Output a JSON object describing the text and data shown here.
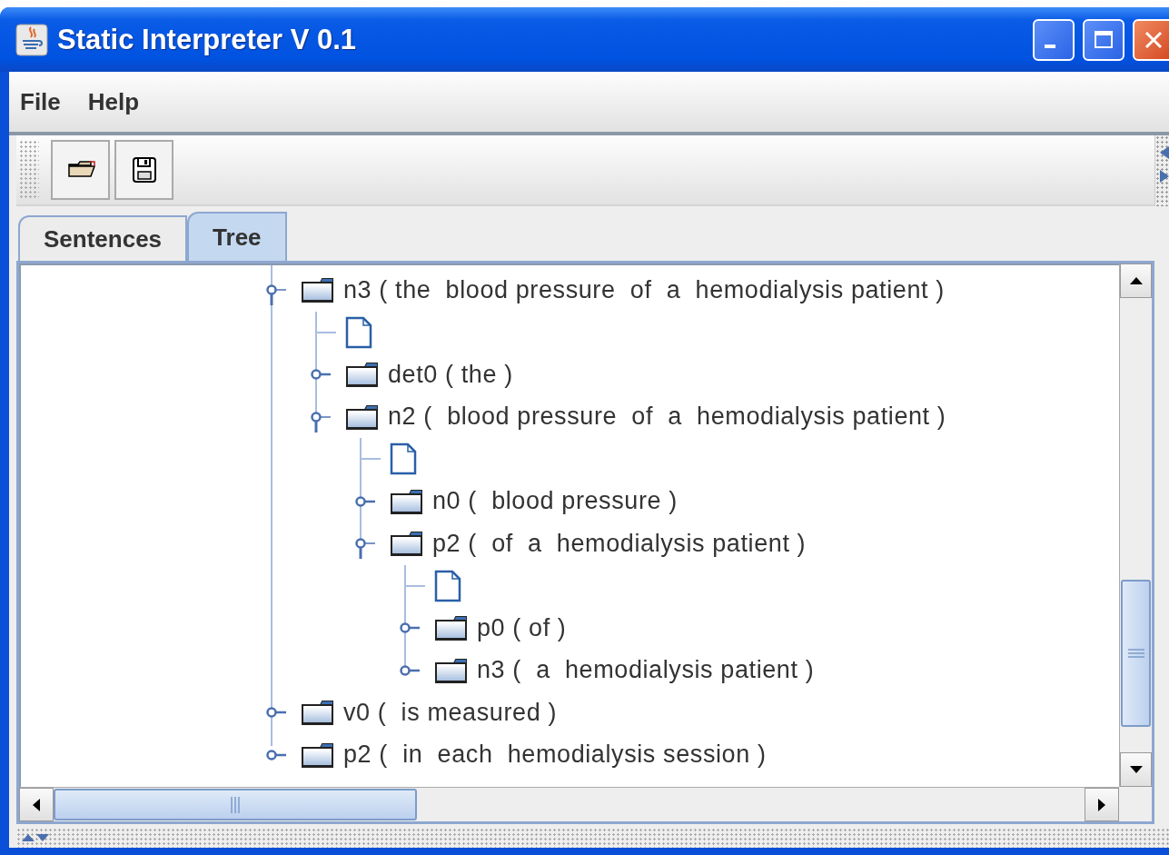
{
  "window": {
    "title": "Static Interpreter V 0.1"
  },
  "menu": [
    {
      "label": "File"
    },
    {
      "label": "Help"
    }
  ],
  "toolbar": [
    {
      "kind": "open"
    },
    {
      "kind": "save"
    }
  ],
  "tabs": [
    {
      "label": "Sentences",
      "selected": false
    },
    {
      "label": "Tree",
      "selected": true
    }
  ],
  "tree": {
    "nodes": [
      {
        "kind": "folder",
        "label": "n3 ( the  blood pressure  of  a  hemodialysis patient )",
        "expanded": true,
        "children": [
          {
            "kind": "leaf"
          },
          {
            "kind": "folder",
            "label": "det0 ( the )",
            "expanded": false
          },
          {
            "kind": "folder",
            "label": "n2 (  blood pressure  of  a  hemodialysis patient )",
            "expanded": true,
            "children": [
              {
                "kind": "leaf"
              },
              {
                "kind": "folder",
                "label": "n0 (  blood pressure )",
                "expanded": false
              },
              {
                "kind": "folder",
                "label": "p2 (  of  a  hemodialysis patient )",
                "expanded": true,
                "children": [
                  {
                    "kind": "leaf"
                  },
                  {
                    "kind": "folder",
                    "label": "p0 ( of )",
                    "expanded": false
                  },
                  {
                    "kind": "folder",
                    "label": "n3 (  a  hemodialysis patient )",
                    "expanded": false
                  }
                ]
              }
            ]
          }
        ]
      },
      {
        "kind": "folder",
        "label": "v0 (  is measured )",
        "expanded": false
      },
      {
        "kind": "folder",
        "label": "p2 (  in  each  hemodialysis session )",
        "expanded": false
      }
    ]
  }
}
